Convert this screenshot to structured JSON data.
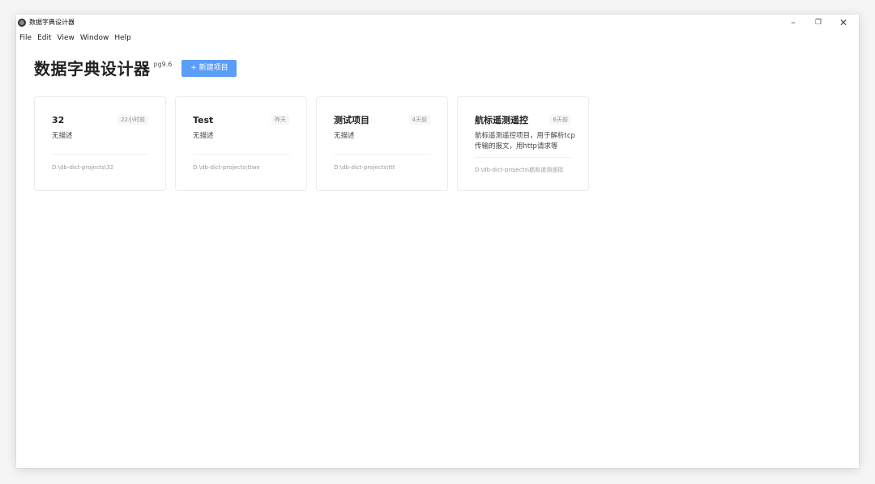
{
  "window": {
    "title": "数据字典设计器"
  },
  "menu": [
    "File",
    "Edit",
    "View",
    "Window",
    "Help"
  ],
  "header": {
    "title": "数据字典设计器",
    "version": "pg9.6",
    "new_button": "+ 新建项目"
  },
  "projects": [
    {
      "name": "32",
      "time": "22小时前",
      "description": "无描述",
      "path": "D:\\db-dict-projects\\32"
    },
    {
      "name": "Test",
      "time": "昨天",
      "description": "无描述",
      "path": "D:\\db-dict-projects\\ttwe"
    },
    {
      "name": "测试项目",
      "time": "4天前",
      "description": "无描述",
      "path": "D:\\db-dict-projects\\ttt"
    },
    {
      "name": "航标遥测遥控",
      "time": "6天前",
      "description": "航标遥测遥控项目，用于解析tcp传输的报文，用http请求等",
      "path": "D:\\db-dict-projects\\航标遥测遥控"
    }
  ]
}
